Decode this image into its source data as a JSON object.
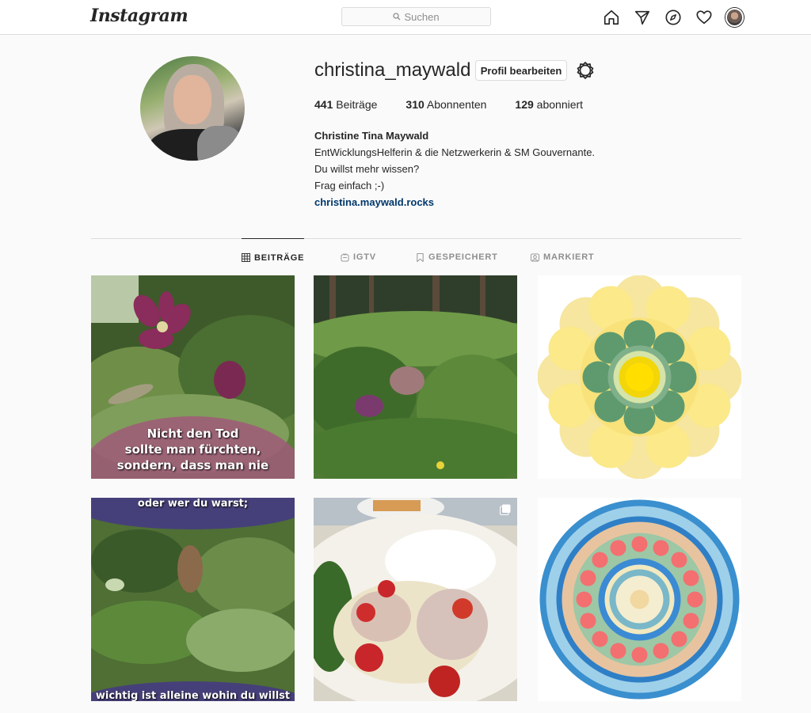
{
  "header": {
    "logo": "Instagram",
    "search_placeholder": "Suchen"
  },
  "profile": {
    "username": "christina_maywald",
    "edit_button": "Profil bearbeiten",
    "stats": [
      {
        "count": "441",
        "label": "Beiträge"
      },
      {
        "count": "310",
        "label": "Abonnenten"
      },
      {
        "count": "129",
        "label": "abonniert"
      }
    ],
    "full_name": "Christine Tina Maywald",
    "bio_lines": [
      "EntWicklungsHelferin & die Netzwerkerin & SM Gouvernante.",
      "Du willst mehr wissen?",
      "Frag einfach ;-)"
    ],
    "website": "christina.maywald.rocks"
  },
  "tabs": [
    {
      "label": "BEITRÄGE",
      "icon": "grid-icon",
      "active": true
    },
    {
      "label": "IGTV",
      "icon": "igtv-icon",
      "active": false
    },
    {
      "label": "GESPEICHERT",
      "icon": "bookmark-icon",
      "active": false
    },
    {
      "label": "MARKIERT",
      "icon": "tagged-icon",
      "active": false
    }
  ],
  "posts": [
    {
      "type": "photo-flower-quote",
      "caption_lines": [
        "Nicht den Tod",
        "sollte man fürchten,",
        "sondern, dass man nie"
      ]
    },
    {
      "type": "photo-garden"
    },
    {
      "type": "mandala-yellow"
    },
    {
      "type": "photo-fern-quote",
      "caption_top": "oder wer du warst;",
      "caption_bottom": "wichtig ist alleine wohin du willst"
    },
    {
      "type": "photo-food",
      "multi": true
    },
    {
      "type": "mandala-blue"
    }
  ]
}
